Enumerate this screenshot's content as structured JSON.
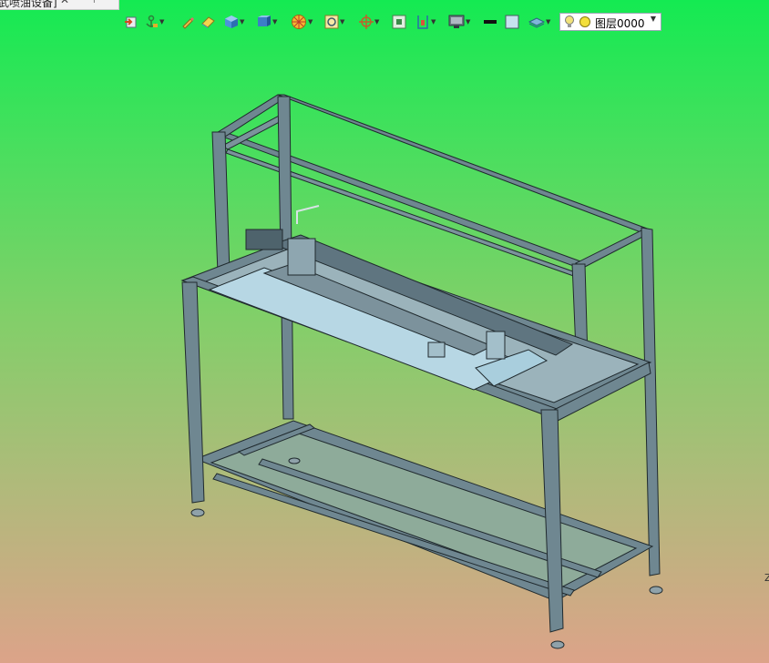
{
  "document_tab": {
    "title": "武喷油设备]",
    "close_glyph": "✕",
    "new_tab_glyph": "+"
  },
  "toolbar": {
    "items": [
      {
        "icon": "import-icon"
      },
      {
        "icon": "anchor-tool-icon",
        "has_dropdown": true
      },
      {
        "icon": "pencil-icon"
      },
      {
        "icon": "eraser-icon"
      },
      {
        "icon": "shaded-cube-icon",
        "has_dropdown": true
      },
      {
        "icon": "view-orientation-icon",
        "has_dropdown": true
      },
      {
        "icon": "section-view-icon",
        "has_dropdown": true
      },
      {
        "icon": "zoom-window-icon",
        "has_dropdown": true
      },
      {
        "icon": "rotate-origin-icon",
        "has_dropdown": true
      },
      {
        "icon": "fit-view-icon"
      },
      {
        "icon": "measure-icon",
        "has_dropdown": true
      },
      {
        "icon": "display-monitor-icon",
        "has_dropdown": true
      },
      {
        "icon": "line-style-icon"
      },
      {
        "icon": "fill-color-icon"
      },
      {
        "icon": "layer-manager-icon",
        "has_dropdown": true
      }
    ],
    "dropdown_glyph": "▼",
    "layer_selector": {
      "value": "图层0000",
      "arrow": "▼",
      "bulb_color": "#f1e27a",
      "dot_color": "#f3df3a"
    }
  },
  "viewport": {
    "gradient_top": "#14ea52",
    "gradient_bottom": "#dca389",
    "edge_mark": "Z"
  },
  "model": {
    "frame_color": "#6f8791",
    "frame_edge_color": "#202a2e",
    "plate_color": "#b7d7e4",
    "feet_color": "#8fa2aa"
  }
}
